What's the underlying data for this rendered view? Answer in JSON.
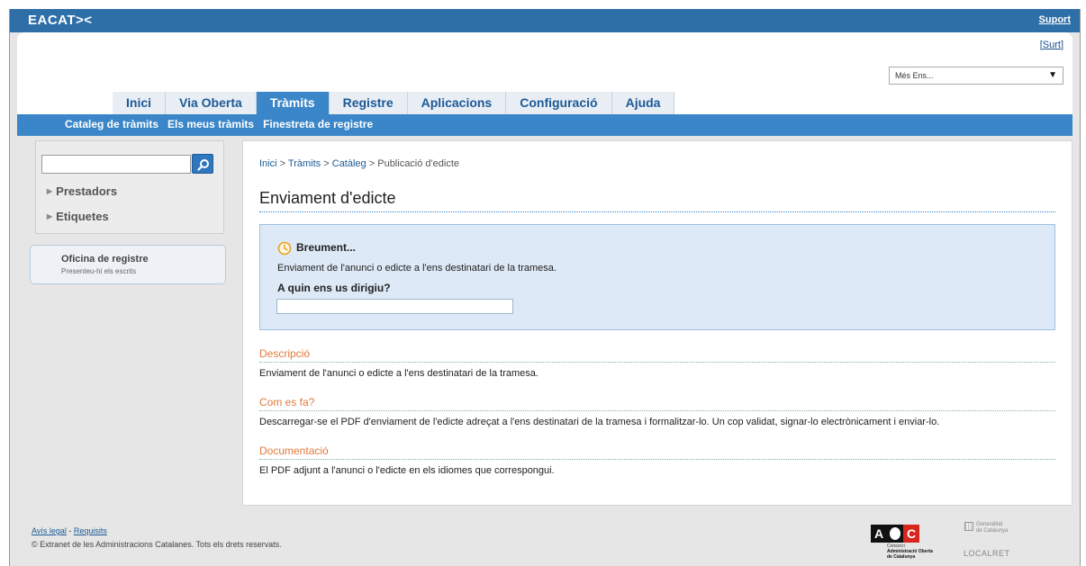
{
  "topbar": {
    "logo": "EACAT><",
    "support_label": "Suport"
  },
  "header": {
    "surt_label": "Surt",
    "ens_select_value": "Més Ens...",
    "tabs": [
      {
        "label": "Inici"
      },
      {
        "label": "Via Oberta"
      },
      {
        "label": "Tràmits"
      },
      {
        "label": "Registre"
      },
      {
        "label": "Aplicacions"
      },
      {
        "label": "Configuració"
      },
      {
        "label": "Ajuda"
      }
    ],
    "subnav": [
      {
        "label": "Cataleg de tràmits"
      },
      {
        "label": "Els meus tràmits"
      },
      {
        "label": "Finestreta de registre"
      }
    ]
  },
  "sidebar": {
    "search_value": "",
    "links": [
      {
        "label": "Prestadors"
      },
      {
        "label": "Etiquetes"
      }
    ],
    "oficina": {
      "title": "Oficina de registre",
      "subtitle": "Presenteu-hi els escrits"
    }
  },
  "content": {
    "breadcrumb": {
      "items": [
        "Inici",
        "Tràmits",
        "Catàleg"
      ],
      "current": "Publicació d'edicte",
      "separator": ">"
    },
    "title": "Enviament d'edicte",
    "breument": {
      "title": "Breument...",
      "text": "Enviament de l'anunci o edicte a l'ens destinatari de la tramesa.",
      "question": "A quin ens us dirigiu?",
      "input_value": ""
    },
    "sections": [
      {
        "title": "Descripció",
        "text": "Enviament de l'anunci o edicte a l'ens destinatari de la tramesa."
      },
      {
        "title": "Com es fa?",
        "text": "Descarregar-se el PDF d'enviament de l'edicte adreçat a l'ens destinatari de la tramesa i formalitzar-lo. Un cop validat, signar-lo electrònicament i enviar-lo."
      },
      {
        "title": "Documentació",
        "text": "El PDF adjunt a l'anunci o l'edicte en els idiomes que correspongui."
      }
    ]
  },
  "footer": {
    "legal_label": "Avís legal",
    "separator": " - ",
    "requisits_label": "Requisits",
    "copyright": "© Extranet de les Administracions Catalanes. Tots els drets reservats.",
    "aoc_logo": {
      "mark_a": "A",
      "mark_c": "C",
      "line1": "Consorci",
      "line2": "Administració Oberta",
      "line3": "de Catalunya"
    },
    "generalitat_logo": {
      "line1": "Generalitat",
      "line2": "de Catalunya"
    },
    "localret_logo": "LOCALRET"
  },
  "colors": {
    "topbar_blue": "#2f6fa8",
    "nav_blue": "#3a86c8",
    "link_blue": "#1c5a96",
    "section_orange": "#e07a3e",
    "info_box_bg": "#dde9f6"
  }
}
